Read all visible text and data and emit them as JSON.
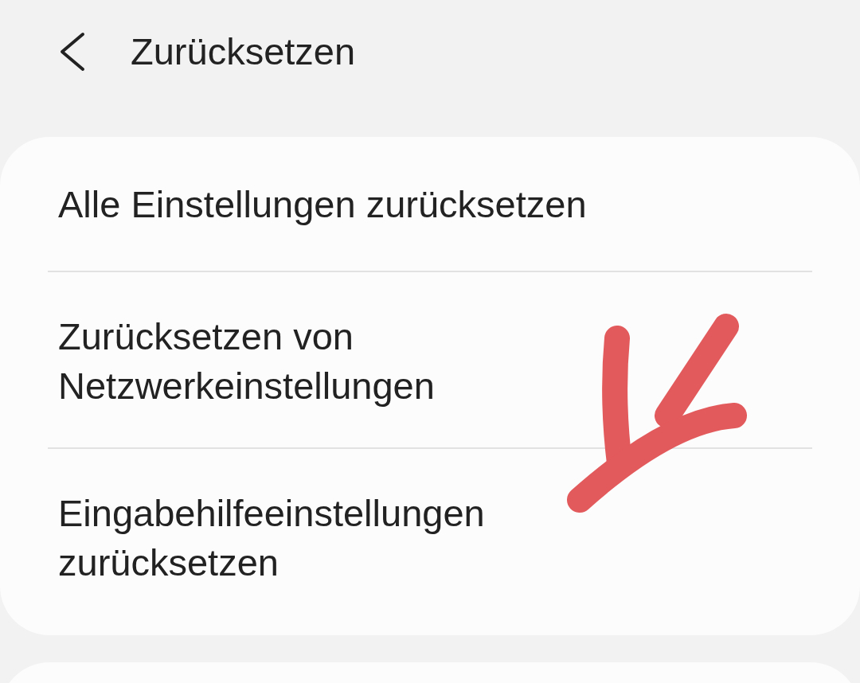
{
  "header": {
    "title": "Zurücksetzen"
  },
  "items": [
    {
      "lines": [
        "Alle Einstellungen zurücksetzen"
      ]
    },
    {
      "lines": [
        "Zurücksetzen von",
        "Netzwerkeinstellungen"
      ]
    },
    {
      "lines": [
        "Eingabehilfeeinstellungen",
        "zurücksetzen"
      ]
    }
  ]
}
